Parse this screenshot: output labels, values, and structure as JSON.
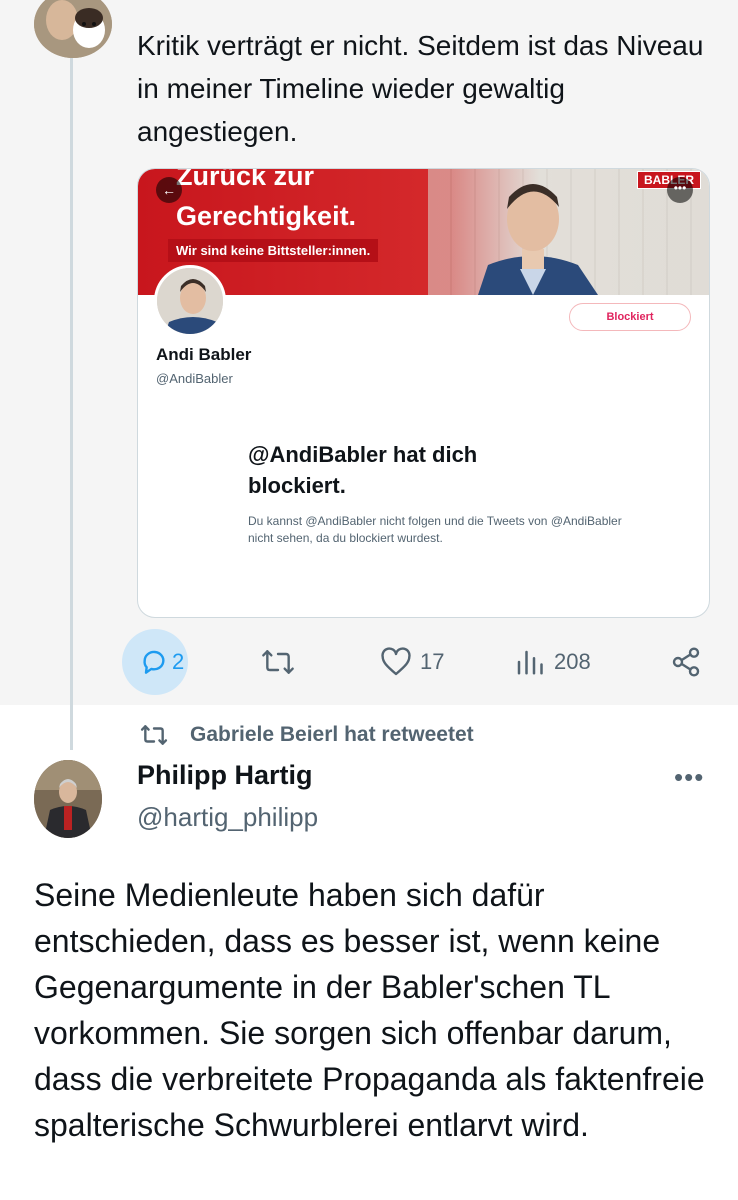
{
  "tweet1": {
    "text": "Kritik verträgt er nicht. Seitdem ist das Niveau in meiner Timeline wieder gewaltig angestiegen.",
    "embedded_screenshot": {
      "banner_line1": "Zurück zur",
      "banner_line2": "Gerechtigkeit.",
      "banner_sub": "Wir sind keine Bittsteller:innen.",
      "banner_brand": "BABLER",
      "blocked_button": "Blockiert",
      "name": "Andi Babler",
      "handle": "@AndiBabler",
      "block_title": "@AndiBabler hat dich blockiert.",
      "block_desc": "Du kannst @AndiBabler nicht folgen und die Tweets von @AndiBabler nicht sehen, da du blockiert wurdest."
    },
    "actions": {
      "replies": "2",
      "retweets": "",
      "likes": "17",
      "views": "208"
    },
    "colors": {
      "reply_active": "#1d9bf0",
      "muted": "#536471"
    }
  },
  "retweet_notice": "Gabriele Beierl hat retweetet",
  "tweet2": {
    "name": "Philipp Hartig",
    "handle": "@hartig_philipp",
    "more": "•••",
    "text": "Seine Medienleute haben sich dafür entschieden, dass es besser ist, wenn keine Gegenargumente in der Babler'schen TL vorkommen. Sie sorgen sich offenbar darum, dass die verbreitete Propaganda als faktenfreie spalterische Schwurblerei entlarvt wird."
  }
}
